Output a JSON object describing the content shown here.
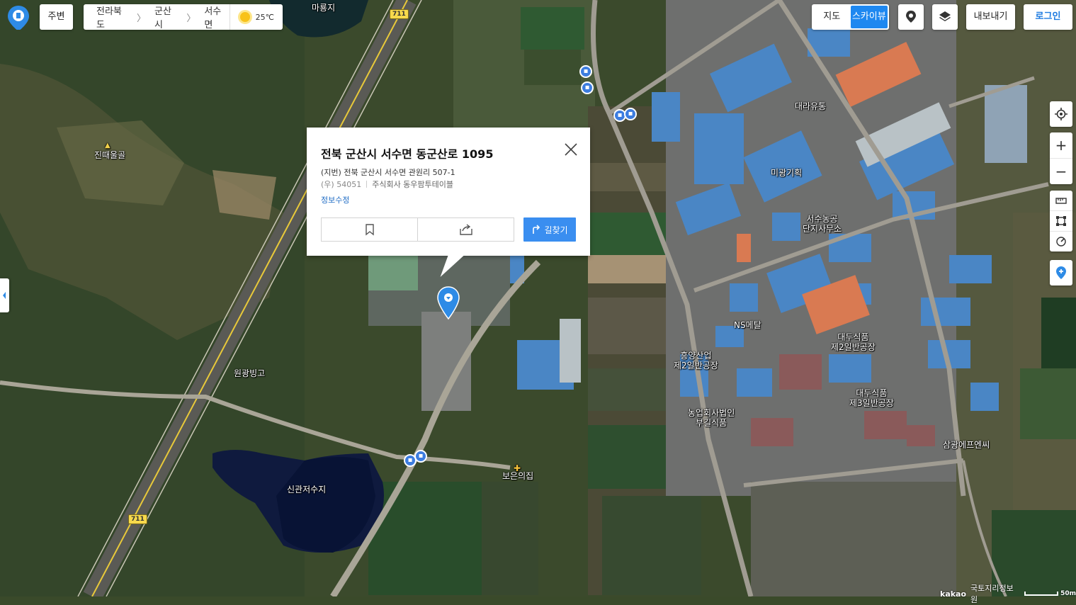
{
  "topbar": {
    "around_label": "주변",
    "breadcrumb": [
      "전라북도",
      "군산시",
      "서수면"
    ],
    "temperature": "25℃",
    "map_types": [
      "지도",
      "스카이뷰"
    ],
    "active_map_type": "스카이뷰",
    "export_label": "내보내기",
    "login_label": "로그인"
  },
  "popup": {
    "title": "전북 군산시 서수면 동군산로 1095",
    "jibun": "(지번) 전북 군산시 서수면 관원리 507-1",
    "postal": "(우) 54051",
    "company": "주식회사 동우팜투테이블",
    "edit_label": "정보수정",
    "route_label": "길찾기"
  },
  "map_labels": {
    "maryongji": "마룡지",
    "jinttaeulgol": "진때울골",
    "daera": "대라유통",
    "migwang": "미광기획",
    "seosu_1": "서수농공",
    "seosu_2": "단지사무소",
    "ns": "NS메탈",
    "daedu2_1": "대두식품",
    "daedu2_2": "제2일반공장",
    "heungyang_1": "흥양산업",
    "heungyang_2": "제2일반공장",
    "wongwang": "원광빙고",
    "daedu3_1": "대두식품",
    "daedu3_2": "제3일반공장",
    "nong_1": "농업회사법인",
    "nong_2": "부길식품",
    "samgwang": "삼광에프엔씨",
    "boeun": "보은의집",
    "singwan": "신관저수지",
    "route_711_top": "711",
    "route_711_bottom": "711"
  },
  "footer": {
    "brand": "kakao",
    "provider": "국토지리정보원",
    "scale": "50m"
  },
  "colors": {
    "accent": "#1e88f0",
    "route_button": "#3a8ef0",
    "marker": "#2e8be6",
    "road_yellow": "#e8c93a"
  }
}
